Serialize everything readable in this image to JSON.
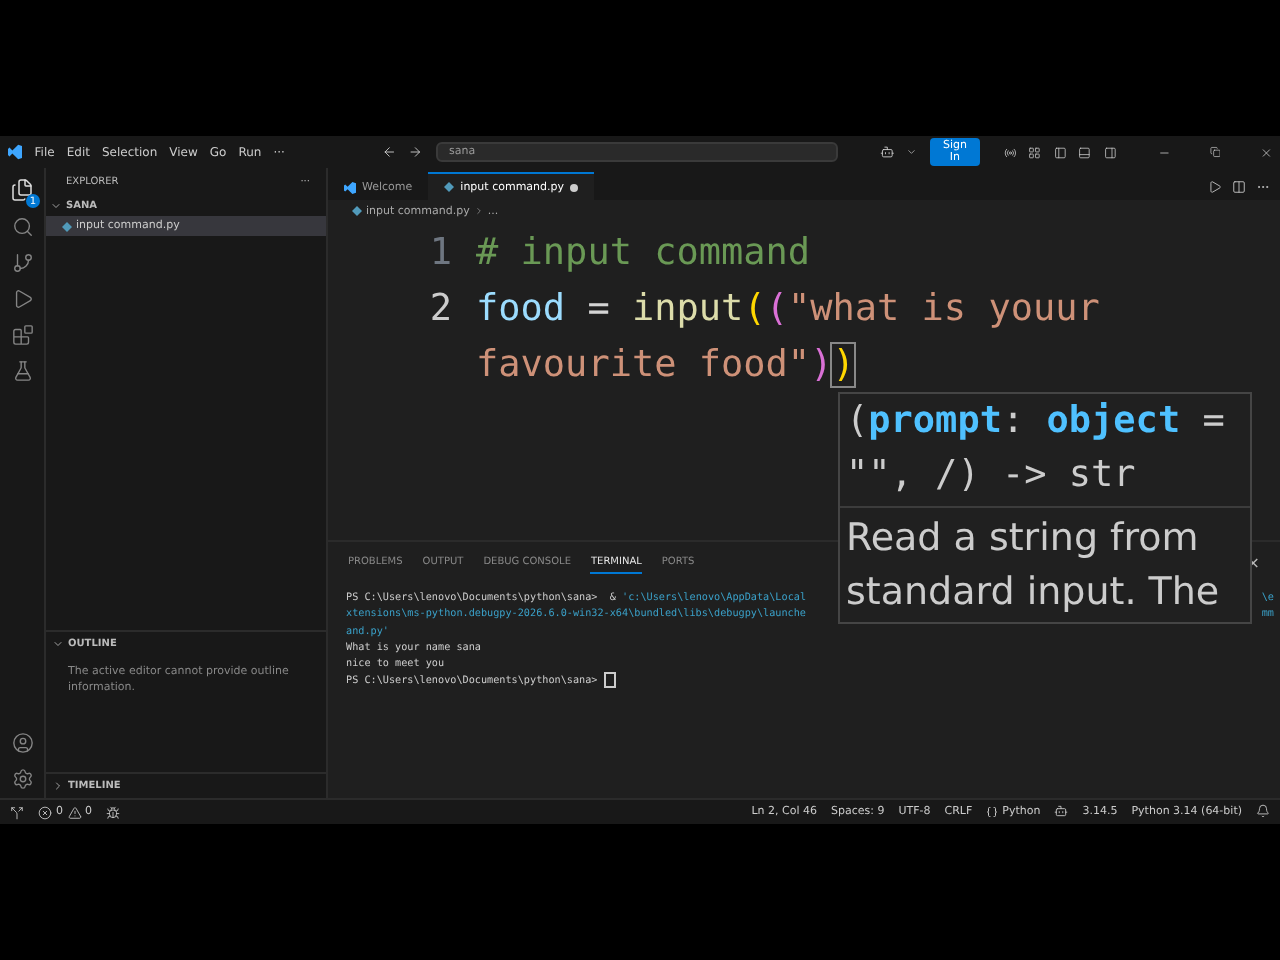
{
  "title_bar": {
    "menu": [
      "File",
      "Edit",
      "Selection",
      "View",
      "Go",
      "Run",
      "···"
    ],
    "search": {
      "value": "sana"
    },
    "sign_in": "Sign In"
  },
  "activity_bar": {
    "explorer_badge": "1"
  },
  "sidebar": {
    "title": "EXPLORER",
    "more": "···",
    "folder": {
      "name": "SANA",
      "expanded": true,
      "files": [
        {
          "name": "input command.py",
          "selected": true
        }
      ]
    },
    "outline": {
      "title": "OUTLINE",
      "expanded": true,
      "message": "The active editor cannot provide outline information."
    },
    "timeline": {
      "title": "TIMELINE",
      "expanded": false
    }
  },
  "tabs": [
    {
      "label": "Welcome",
      "selected": false,
      "dirty": false
    },
    {
      "label": "input command.py",
      "selected": true,
      "dirty": true
    }
  ],
  "breadcrumb": [
    "input command.py",
    "..."
  ],
  "code": [
    {
      "number": "1",
      "tokens": [
        {
          "kind": "comment",
          "text": "# input command"
        }
      ]
    },
    {
      "number": "2",
      "tokens": [
        {
          "kind": "variable",
          "text": "food"
        },
        {
          "kind": "plain",
          "text": " = "
        },
        {
          "kind": "function",
          "text": "input"
        },
        {
          "kind": "bracket1",
          "text": "("
        },
        {
          "kind": "bracket2",
          "text": "("
        },
        {
          "kind": "string",
          "text": "\"what is youur favourite food\""
        },
        {
          "kind": "bracket2",
          "text": ")"
        },
        {
          "kind": "bracket1match",
          "text": ")"
        }
      ]
    }
  ],
  "hover": {
    "signature": [
      {
        "kind": "punct",
        "text": "("
      },
      {
        "kind": "param",
        "text": "prompt"
      },
      {
        "kind": "punct",
        "text": ": "
      },
      {
        "kind": "type",
        "text": "object"
      },
      {
        "kind": "punct",
        "text": " = \"\", /) -> str"
      }
    ],
    "doc": "Read a string from standard input. The"
  },
  "panel": {
    "tabs": [
      {
        "label": "PROBLEMS",
        "selected": false
      },
      {
        "label": "OUTPUT",
        "selected": false
      },
      {
        "label": "DEBUG CONSOLE",
        "selected": false
      },
      {
        "label": "TERMINAL",
        "selected": true
      },
      {
        "label": "PORTS",
        "selected": false
      }
    ],
    "close": "×",
    "terminal": [
      {
        "left": [
          {
            "kind": "prompt",
            "text": "PS C:\\Users\\lenovo\\Documents\\python\\sana>  & "
          },
          {
            "kind": "path",
            "text": "'c:\\Users\\lenovo\\AppData\\Local"
          }
        ],
        "right": [
          {
            "kind": "path",
            "text": "\\e"
          }
        ]
      },
      {
        "left": [
          {
            "kind": "path",
            "text": "xtensions\\ms-python.debugpy-2026.6.0-win32-x64\\bundled\\libs\\debugpy\\launche"
          }
        ],
        "right": [
          {
            "kind": "path",
            "text": "mm"
          }
        ]
      },
      {
        "left": [
          {
            "kind": "path",
            "text": "and.py'"
          }
        ]
      },
      {
        "left": [
          {
            "kind": "prompt",
            "text": "What is your name sana"
          }
        ]
      },
      {
        "left": [
          {
            "kind": "prompt",
            "text": "nice to meet you"
          }
        ]
      },
      {
        "left": [
          {
            "kind": "prompt",
            "text": "PS C:\\Users\\lenovo\\Documents\\python\\sana> "
          }
        ],
        "cursor": true
      }
    ]
  },
  "status_bar": {
    "errors": "0",
    "warnings": "0",
    "right": [
      {
        "kind": "text",
        "text": "Ln 2, Col 46"
      },
      {
        "kind": "text",
        "text": "Spaces: 9"
      },
      {
        "kind": "text",
        "text": "UTF-8"
      },
      {
        "kind": "text",
        "text": "CRLF"
      },
      {
        "kind": "language",
        "text": "Python"
      },
      {
        "kind": "copilot"
      },
      {
        "kind": "text",
        "text": "3.14.5"
      },
      {
        "kind": "text",
        "text": "Python 3.14 (64-bit)"
      },
      {
        "kind": "bell"
      }
    ]
  }
}
